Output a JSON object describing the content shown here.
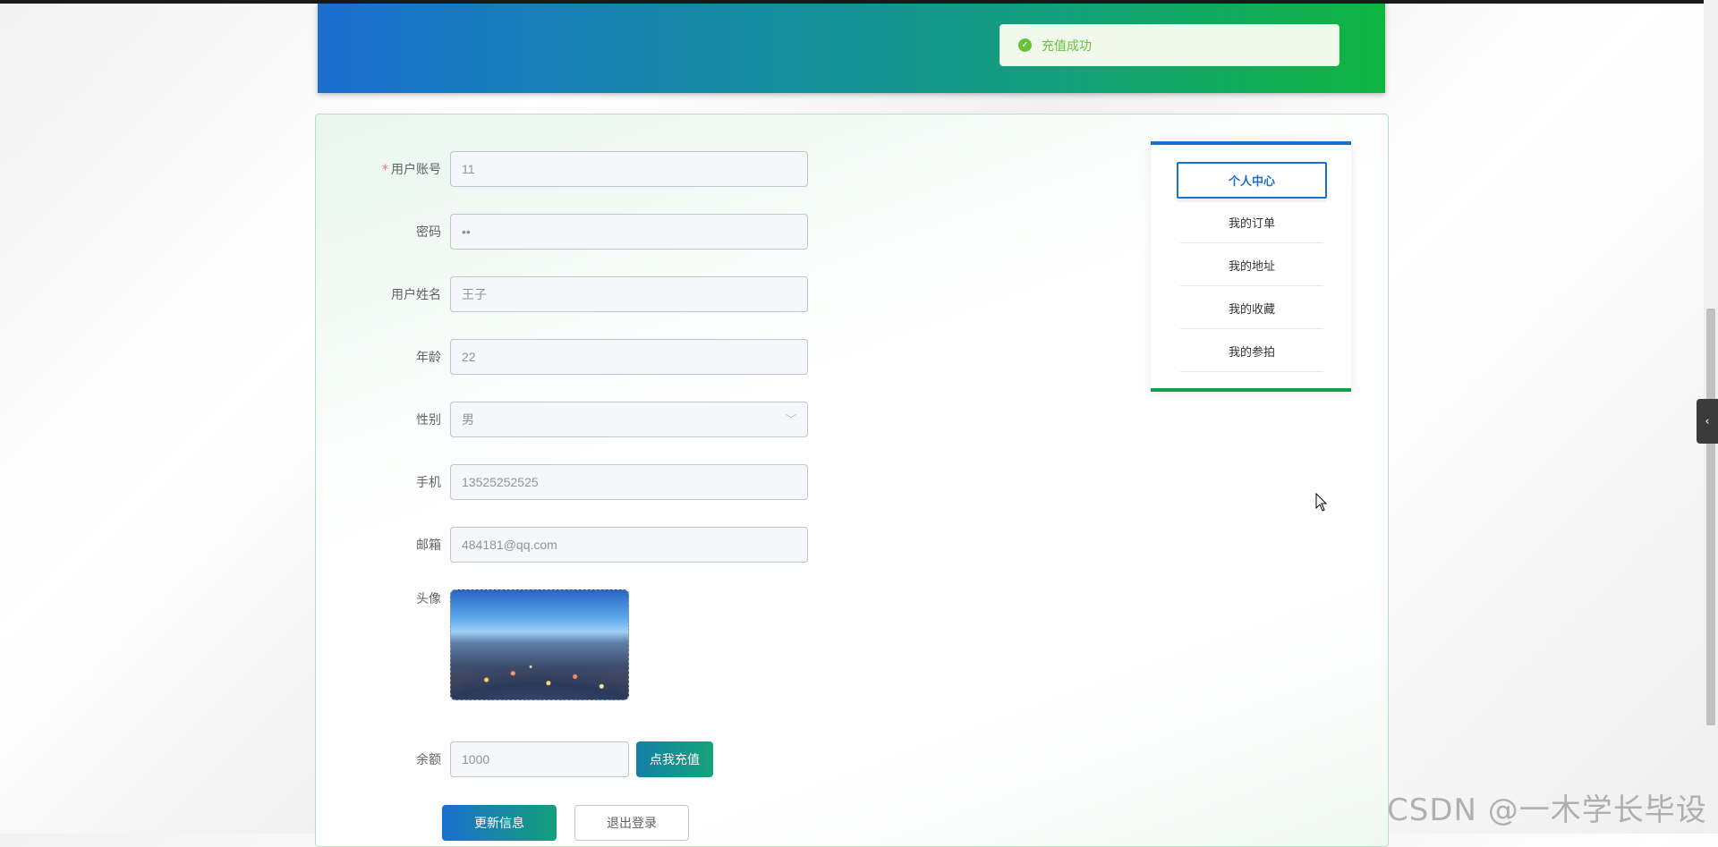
{
  "toast": {
    "text": "充值成功",
    "icon": "check-circle-icon"
  },
  "form": {
    "account": {
      "label": "用户账号",
      "required": "*",
      "value": "11"
    },
    "password": {
      "label": "密码",
      "value": "••"
    },
    "name": {
      "label": "用户姓名",
      "value": "王子"
    },
    "age": {
      "label": "年龄",
      "value": "22"
    },
    "gender": {
      "label": "性别",
      "value": "男"
    },
    "phone": {
      "label": "手机",
      "value": "13525252525"
    },
    "email": {
      "label": "邮箱",
      "value": "484181@qq.com"
    },
    "avatar": {
      "label": "头像"
    },
    "balance": {
      "label": "余额",
      "value": "1000"
    },
    "recharge_button": "点我充值",
    "update_button": "更新信息",
    "logout_button": "退出登录"
  },
  "menu": {
    "items": [
      {
        "label": "个人中心"
      },
      {
        "label": "我的订单"
      },
      {
        "label": "我的地址"
      },
      {
        "label": "我的收藏"
      },
      {
        "label": "我的参拍"
      }
    ]
  },
  "side_toggle": "‹",
  "watermark": "CSDN @一木学长毕设",
  "colors": {
    "primary": "#1a6fcf",
    "accent": "#13a04a",
    "success": "#67c23a"
  }
}
